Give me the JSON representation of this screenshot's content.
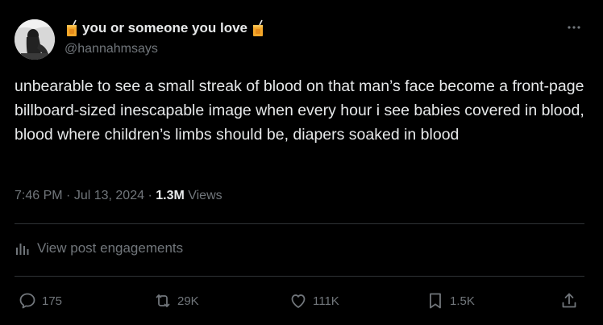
{
  "author": {
    "display_name": "you or someone you love",
    "handle": "@hannahmsays",
    "name_emoji": "beverage-box-emoji"
  },
  "post": {
    "text": "unbearable to see a small streak of blood on that man’s face become a front-page billboard-sized inescapable image when every hour i see babies covered in blood, blood where children’s limbs should be, diapers soaked in blood",
    "time": "7:46 PM",
    "date": "Jul 13, 2024",
    "sep1": " · ",
    "sep2": " · ",
    "views_count": "1.3M",
    "views_label": " Views"
  },
  "engagements_label": "View post engagements",
  "actions": {
    "replies": "175",
    "reposts": "29K",
    "likes": "111K",
    "bookmarks": "1.5K"
  },
  "icons": {
    "more": "more-icon",
    "engagements": "analytics-icon",
    "reply": "reply-icon",
    "repost": "repost-icon",
    "like": "heart-icon",
    "bookmark": "bookmark-icon",
    "share": "share-icon"
  },
  "colors": {
    "background": "#000000",
    "text_primary": "#e7e9ea",
    "text_secondary": "#71767b",
    "divider": "#2f3336"
  }
}
